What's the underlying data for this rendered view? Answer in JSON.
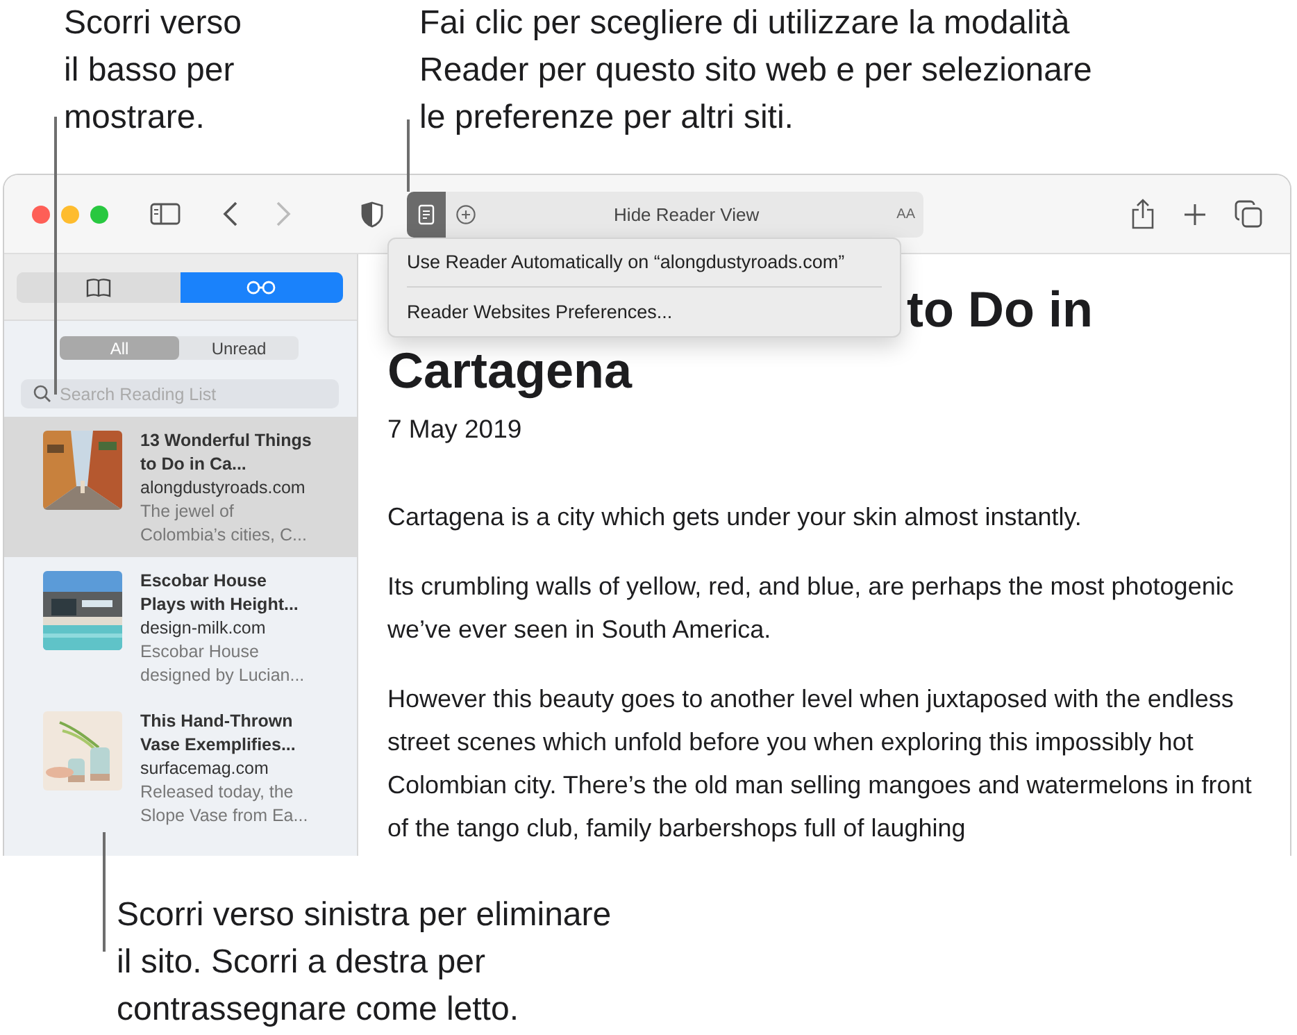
{
  "callouts": {
    "top_left": [
      "Scorri verso",
      "il basso per",
      "mostrare."
    ],
    "top_right": [
      "Fai clic per scegliere di utilizzare la modalità",
      "Reader per questo sito web e per selezionare",
      "le preferenze per altri siti."
    ],
    "bottom": [
      "Scorri verso sinistra per eliminare",
      "il sito. Scorri a destra per",
      "contrassegnare come letto."
    ]
  },
  "toolbar": {
    "back_disabled": false,
    "forward_disabled": true,
    "reader_on": true,
    "address_text": "Hide Reader View",
    "text_size": "AA"
  },
  "reader_menu": {
    "items": [
      "Use Reader Automatically on “alongdustyroads.com”",
      "Reader Websites Preferences..."
    ]
  },
  "sidebar": {
    "tabs": [
      {
        "kind": "bookmarks",
        "selected": false
      },
      {
        "kind": "reading-list",
        "selected": true
      }
    ],
    "filters": [
      {
        "label": "All",
        "selected": true
      },
      {
        "label": "Unread",
        "selected": false
      }
    ],
    "search": {
      "placeholder": "Search Reading List"
    },
    "items": [
      {
        "title": "13 Wonderful Things to Do in Ca...",
        "domain": "alongdustyroads.com",
        "snippet": "The jewel of Colombia’s cities, C...",
        "selected": true,
        "kind": "street"
      },
      {
        "title": "Escobar House Plays with Height...",
        "domain": "design-milk.com",
        "snippet": "Escobar House designed by Lucian...",
        "selected": false,
        "kind": "pool"
      },
      {
        "title": "This Hand-Thrown Vase Exemplifies...",
        "domain": "surfacemag.com",
        "snippet": "Released today, the Slope Vase from Ea...",
        "selected": false,
        "kind": "vase"
      }
    ]
  },
  "article": {
    "title_lines": [
      "to Do in",
      "Cartagena"
    ],
    "date": "7 May 2019",
    "paragraphs": [
      "Cartagena is a city which gets under your skin almost instantly.",
      "Its crumbling walls of yellow, red, and blue, are perhaps the most photogenic we’ve ever seen in South America.",
      "However this beauty goes to another level when juxtaposed with the endless street scenes which unfold before you when exploring this impossibly hot Colombian city. There’s the old man selling mangoes and watermelons in front of the tango club, family barbershops full of laughing"
    ]
  }
}
